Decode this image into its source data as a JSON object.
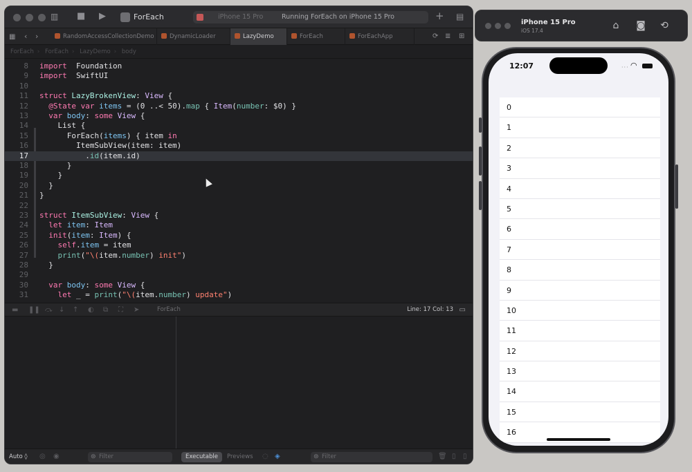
{
  "xcode": {
    "scheme_name": "ForEach",
    "run_destination": "iPhone 15 Pro",
    "activity_status": "Running ForEach on iPhone 15 Pro",
    "tabs": [
      {
        "label": "RandomAccessCollectionDemo"
      },
      {
        "label": "DynamicLoader"
      },
      {
        "label": "LazyDemo",
        "active": true
      },
      {
        "label": "ForEach"
      },
      {
        "label": "ForEachApp"
      }
    ],
    "breadcrumb": [
      "ForEach",
      "ForEach",
      "LazyDemo",
      "body"
    ],
    "code_lines": [
      {
        "n": "8",
        "tokens": [
          [
            "k",
            "import"
          ],
          [
            "",
            "  Foundation"
          ]
        ]
      },
      {
        "n": "9",
        "tokens": [
          [
            "k",
            "import"
          ],
          [
            "",
            "  SwiftUI"
          ]
        ]
      },
      {
        "n": "10",
        "tokens": []
      },
      {
        "n": "11",
        "tokens": [
          [
            "k",
            "struct"
          ],
          [
            "",
            " "
          ],
          [
            "t",
            "LazyBrokenView"
          ],
          [
            "",
            ": "
          ],
          [
            "ty",
            "View"
          ],
          [
            "",
            " {"
          ]
        ]
      },
      {
        "n": "12",
        "tokens": [
          [
            "",
            "  "
          ],
          [
            "k",
            "@State"
          ],
          [
            "",
            " "
          ],
          [
            "k",
            "var"
          ],
          [
            "",
            " "
          ],
          [
            "p",
            "items"
          ],
          [
            "",
            " = (0 ..< 50)."
          ],
          [
            "fn",
            "map"
          ],
          [
            "",
            " { "
          ],
          [
            "ty",
            "Item"
          ],
          [
            "",
            "("
          ],
          [
            "fn",
            "number"
          ],
          [
            "",
            ": $0) }"
          ]
        ]
      },
      {
        "n": "13",
        "tokens": [
          [
            "",
            "  "
          ],
          [
            "k",
            "var"
          ],
          [
            "",
            " "
          ],
          [
            "p",
            "body"
          ],
          [
            "",
            ": "
          ],
          [
            "k",
            "some"
          ],
          [
            "",
            " "
          ],
          [
            "ty",
            "View"
          ],
          [
            "",
            " {"
          ]
        ]
      },
      {
        "n": "14",
        "tokens": [
          [
            "",
            "    List {"
          ]
        ]
      },
      {
        "n": "15",
        "tokens": [
          [
            "",
            "      ForEach("
          ],
          [
            "p",
            "items"
          ],
          [
            "",
            ") { item "
          ],
          [
            "k",
            "in"
          ]
        ]
      },
      {
        "n": "16",
        "tokens": [
          [
            "",
            "        ItemSubView(item: item)"
          ]
        ]
      },
      {
        "n": "17",
        "hl": true,
        "tokens": [
          [
            "",
            "          ."
          ],
          [
            "fn",
            "id"
          ],
          [
            "",
            "(item.id)"
          ]
        ]
      },
      {
        "n": "18",
        "tokens": [
          [
            "",
            "      }"
          ]
        ]
      },
      {
        "n": "19",
        "tokens": [
          [
            "",
            "    }"
          ]
        ]
      },
      {
        "n": "20",
        "tokens": [
          [
            "",
            "  }"
          ]
        ]
      },
      {
        "n": "21",
        "tokens": [
          [
            "",
            "}"
          ]
        ]
      },
      {
        "n": "22",
        "tokens": []
      },
      {
        "n": "23",
        "tokens": [
          [
            "k",
            "struct"
          ],
          [
            "",
            " "
          ],
          [
            "t",
            "ItemSubView"
          ],
          [
            "",
            ": "
          ],
          [
            "ty",
            "View"
          ],
          [
            "",
            " {"
          ]
        ]
      },
      {
        "n": "24",
        "tokens": [
          [
            "",
            "  "
          ],
          [
            "k",
            "let"
          ],
          [
            "",
            " "
          ],
          [
            "p",
            "item"
          ],
          [
            "",
            ": "
          ],
          [
            "ty",
            "Item"
          ]
        ]
      },
      {
        "n": "25",
        "tokens": [
          [
            "",
            "  "
          ],
          [
            "k",
            "init"
          ],
          [
            "",
            "("
          ],
          [
            "p",
            "item"
          ],
          [
            "",
            ": "
          ],
          [
            "ty",
            "Item"
          ],
          [
            "",
            ") {"
          ]
        ]
      },
      {
        "n": "26",
        "tokens": [
          [
            "",
            "    "
          ],
          [
            "k",
            "self"
          ],
          [
            "",
            "."
          ],
          [
            "p",
            "item"
          ],
          [
            "",
            " = item"
          ]
        ]
      },
      {
        "n": "27",
        "tokens": [
          [
            "",
            "    "
          ],
          [
            "fn",
            "print"
          ],
          [
            "",
            "("
          ],
          [
            "s",
            "\"\\("
          ],
          [
            "",
            "item."
          ],
          [
            "fn",
            "number"
          ],
          [
            "",
            ")"
          ],
          [
            "s",
            " init\""
          ],
          [
            "",
            ")"
          ]
        ]
      },
      {
        "n": "28",
        "tokens": [
          [
            "",
            "  }"
          ]
        ]
      },
      {
        "n": "29",
        "tokens": []
      },
      {
        "n": "30",
        "tokens": [
          [
            "",
            "  "
          ],
          [
            "k",
            "var"
          ],
          [
            "",
            " "
          ],
          [
            "p",
            "body"
          ],
          [
            "",
            ": "
          ],
          [
            "k",
            "some"
          ],
          [
            "",
            " "
          ],
          [
            "ty",
            "View"
          ],
          [
            "",
            " {"
          ]
        ]
      },
      {
        "n": "31",
        "tokens": [
          [
            "",
            "    "
          ],
          [
            "k",
            "let"
          ],
          [
            "",
            " _ = "
          ],
          [
            "fn",
            "print"
          ],
          [
            "",
            "("
          ],
          [
            "s",
            "\"\\("
          ],
          [
            "",
            "item."
          ],
          [
            "fn",
            "number"
          ],
          [
            "",
            ")"
          ],
          [
            "s",
            " update\""
          ],
          [
            "",
            ")"
          ]
        ]
      }
    ],
    "debug_target": "ForEach",
    "cursor_position": "Line: 17  Col: 13",
    "bottom": {
      "auto_label": "Auto ◊",
      "filter_left": "Filter",
      "executable_label": "Executable",
      "previews_label": "Previews",
      "filter_right": "Filter"
    }
  },
  "simulator": {
    "device_name": "iPhone 15 Pro",
    "os_version": "iOS 17.4",
    "time": "12:07",
    "list_items": [
      "0",
      "1",
      "2",
      "3",
      "4",
      "5",
      "6",
      "7",
      "8",
      "9",
      "10",
      "11",
      "12",
      "13",
      "14",
      "15",
      "16"
    ]
  },
  "colors": {
    "keyword": "#ff7ab2",
    "type_decl": "#acf2e4",
    "property": "#7ec5f2",
    "string": "#ff8170",
    "type_ref": "#dabaff"
  }
}
